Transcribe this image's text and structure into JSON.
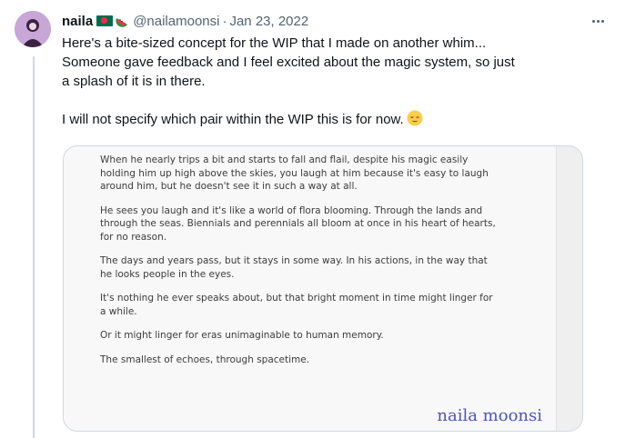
{
  "author": {
    "name": "naila",
    "handle": "@nailamoonsi",
    "date": "Jan 23, 2022",
    "separator": "·",
    "badge_icons": [
      "bangladesh-flag-icon",
      "watermelon-icon"
    ]
  },
  "colors": {
    "text": "#0f1419",
    "secondary": "#536471",
    "border": "#cfd9de",
    "signature": "#4a56b5"
  },
  "tweet": {
    "lines": [
      "Here's a bite-sized concept for the WIP that I made on another whim...",
      "Someone gave feedback and I feel excited about the magic system, so just",
      "a splash of it is in there."
    ],
    "closing": "I will not specify which pair within the WIP this is for now."
  },
  "media": {
    "paragraphs": [
      "When he nearly trips a bit and starts to fall and flail, despite his magic easily holding him up high above the skies, you laugh at him because it's easy to laugh around him, but he doesn't see it in such a way at all.",
      "He sees you laugh and it's like a world of flora blooming. Through the lands and through the seas. Biennials and perennials all bloom at once in his heart of hearts, for no reason.",
      "The days and years pass, but it stays in some way. In his actions, in the way that he looks people in the eyes.",
      "It's nothing he ever speaks about, but that bright moment in time might linger for a while.",
      "Or it might linger for eras unimaginable to human memory.",
      "The smallest of echoes, through spacetime."
    ],
    "signature": "naila moonsi"
  }
}
